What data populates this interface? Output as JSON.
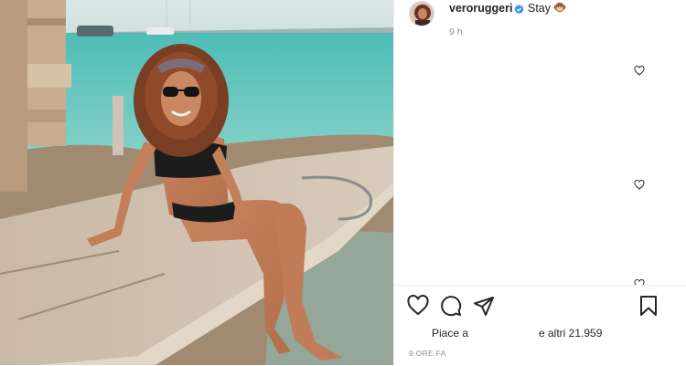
{
  "post": {
    "username": "veroruggeri",
    "caption": "Stay",
    "caption_emoji": "monkey-face-icon",
    "time_ago": "9 h",
    "likes_prefix": "Piace a",
    "likes_suffix": "e altri 21.959",
    "time_full": "9 ORE FA"
  },
  "icons": {
    "like": "heart-icon",
    "comment": "comment-icon",
    "share": "share-icon",
    "save": "bookmark-icon",
    "verified": "verified-badge-icon"
  },
  "colors": {
    "text": "#262626",
    "muted": "#8e8e8e",
    "verified": "#3897f0",
    "border": "#efefef"
  }
}
